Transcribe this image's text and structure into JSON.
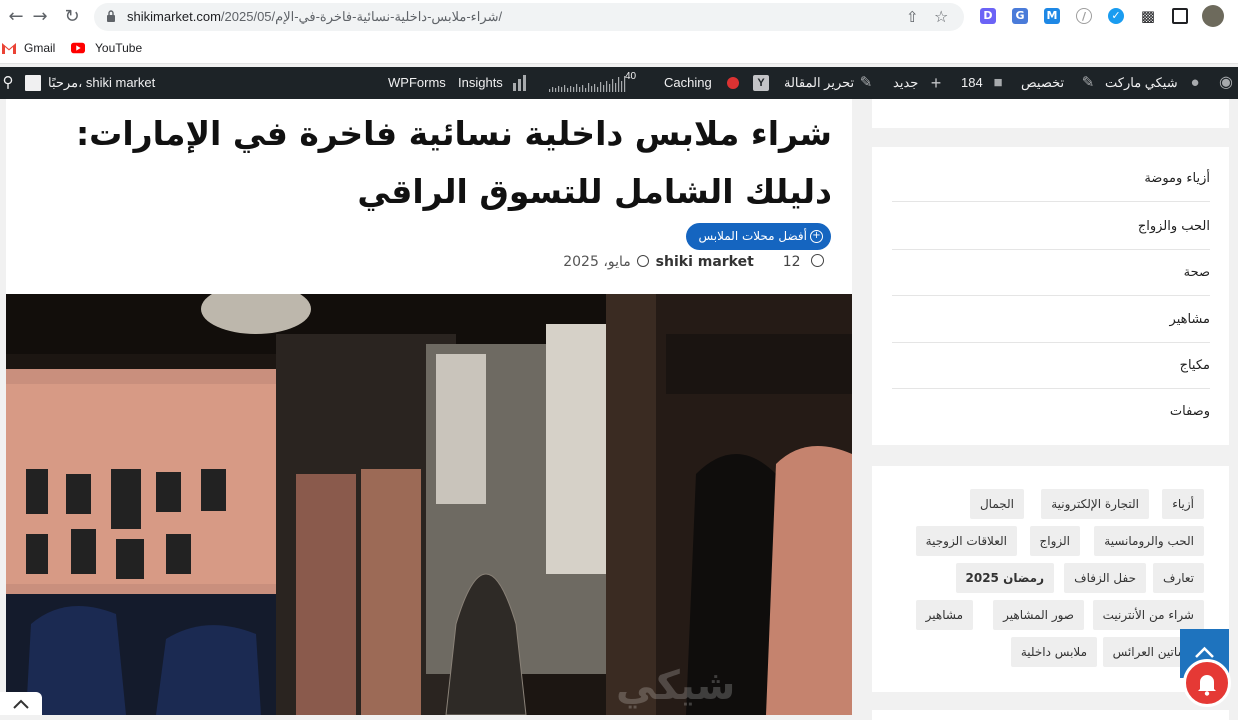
{
  "browser": {
    "url_domain": "shikimarket.com",
    "url_path": "/2025/05/شراء-ملابس-داخلية-نسائية-فاخرة-في-الإم/",
    "bookmarks": [
      {
        "label": "Gmail",
        "icon": "gmail-icon"
      },
      {
        "label": "YouTube",
        "icon": "youtube-icon"
      }
    ],
    "extensions": [
      "d-extension-icon",
      "translate-extension-icon",
      "m-extension-icon",
      "blocked-extension-icon",
      "check-extension-icon",
      "puzzle-icon",
      "sidebar-icon",
      "profile-avatar"
    ]
  },
  "adminbar": {
    "site_name": "شيكي ماركت",
    "customize": "تخصيص",
    "comments_count": "184",
    "new": "جديد",
    "edit_post": "تحرير المقالة",
    "caching": "Caching",
    "stats_number": "40",
    "insights": "Insights",
    "wpforms": "WPForms",
    "greeting": "مرحبًا، shiki market"
  },
  "post": {
    "title": "شراء ملابس داخلية نسائية فاخرة في الإمارات: دليلك الشامل للتسوق الراقي",
    "category": "أفضل محلات الملابس",
    "author": "shiki market",
    "date_prefix": "12",
    "date_rest": "مايو، 2025",
    "watermark": "شيكي"
  },
  "sidebar": {
    "categories": [
      "أزياء وموضة",
      "الحب والزواج",
      "صحة",
      "مشاهير",
      "مكياج",
      "وصفات"
    ],
    "tags": [
      [
        "أزياء",
        "التجارة الإلكترونية",
        "الجمال"
      ],
      [
        "الحب والرومانسية",
        "الزواج",
        "العلاقات الزوجية"
      ],
      [
        "تعارف",
        "حفل الزفاف",
        "رمضان 2025"
      ],
      [
        "شراء من الأنترنيت",
        "صور المشاهير",
        "مشاهير"
      ],
      [
        "فساتين العرائس",
        "ملابس داخلية"
      ]
    ]
  },
  "colors": {
    "admin_bar": "#1d2327",
    "category_pill": "#1565c0",
    "scroll_top": "#1e73be",
    "notification": "#e53935"
  }
}
